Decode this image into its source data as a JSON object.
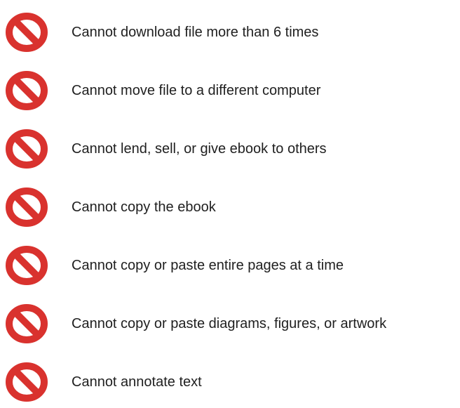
{
  "icon": {
    "name": "prohibited-icon",
    "color": "#d9322e",
    "stroke_color": "#c12623"
  },
  "items": [
    {
      "label": "Cannot download file more than 6 times"
    },
    {
      "label": "Cannot move file to a different computer"
    },
    {
      "label": "Cannot lend, sell, or give ebook to others"
    },
    {
      "label": "Cannot copy the ebook"
    },
    {
      "label": "Cannot copy or paste entire pages at a time"
    },
    {
      "label": "Cannot copy or paste diagrams, figures, or artwork"
    },
    {
      "label": "Cannot annotate text"
    }
  ]
}
